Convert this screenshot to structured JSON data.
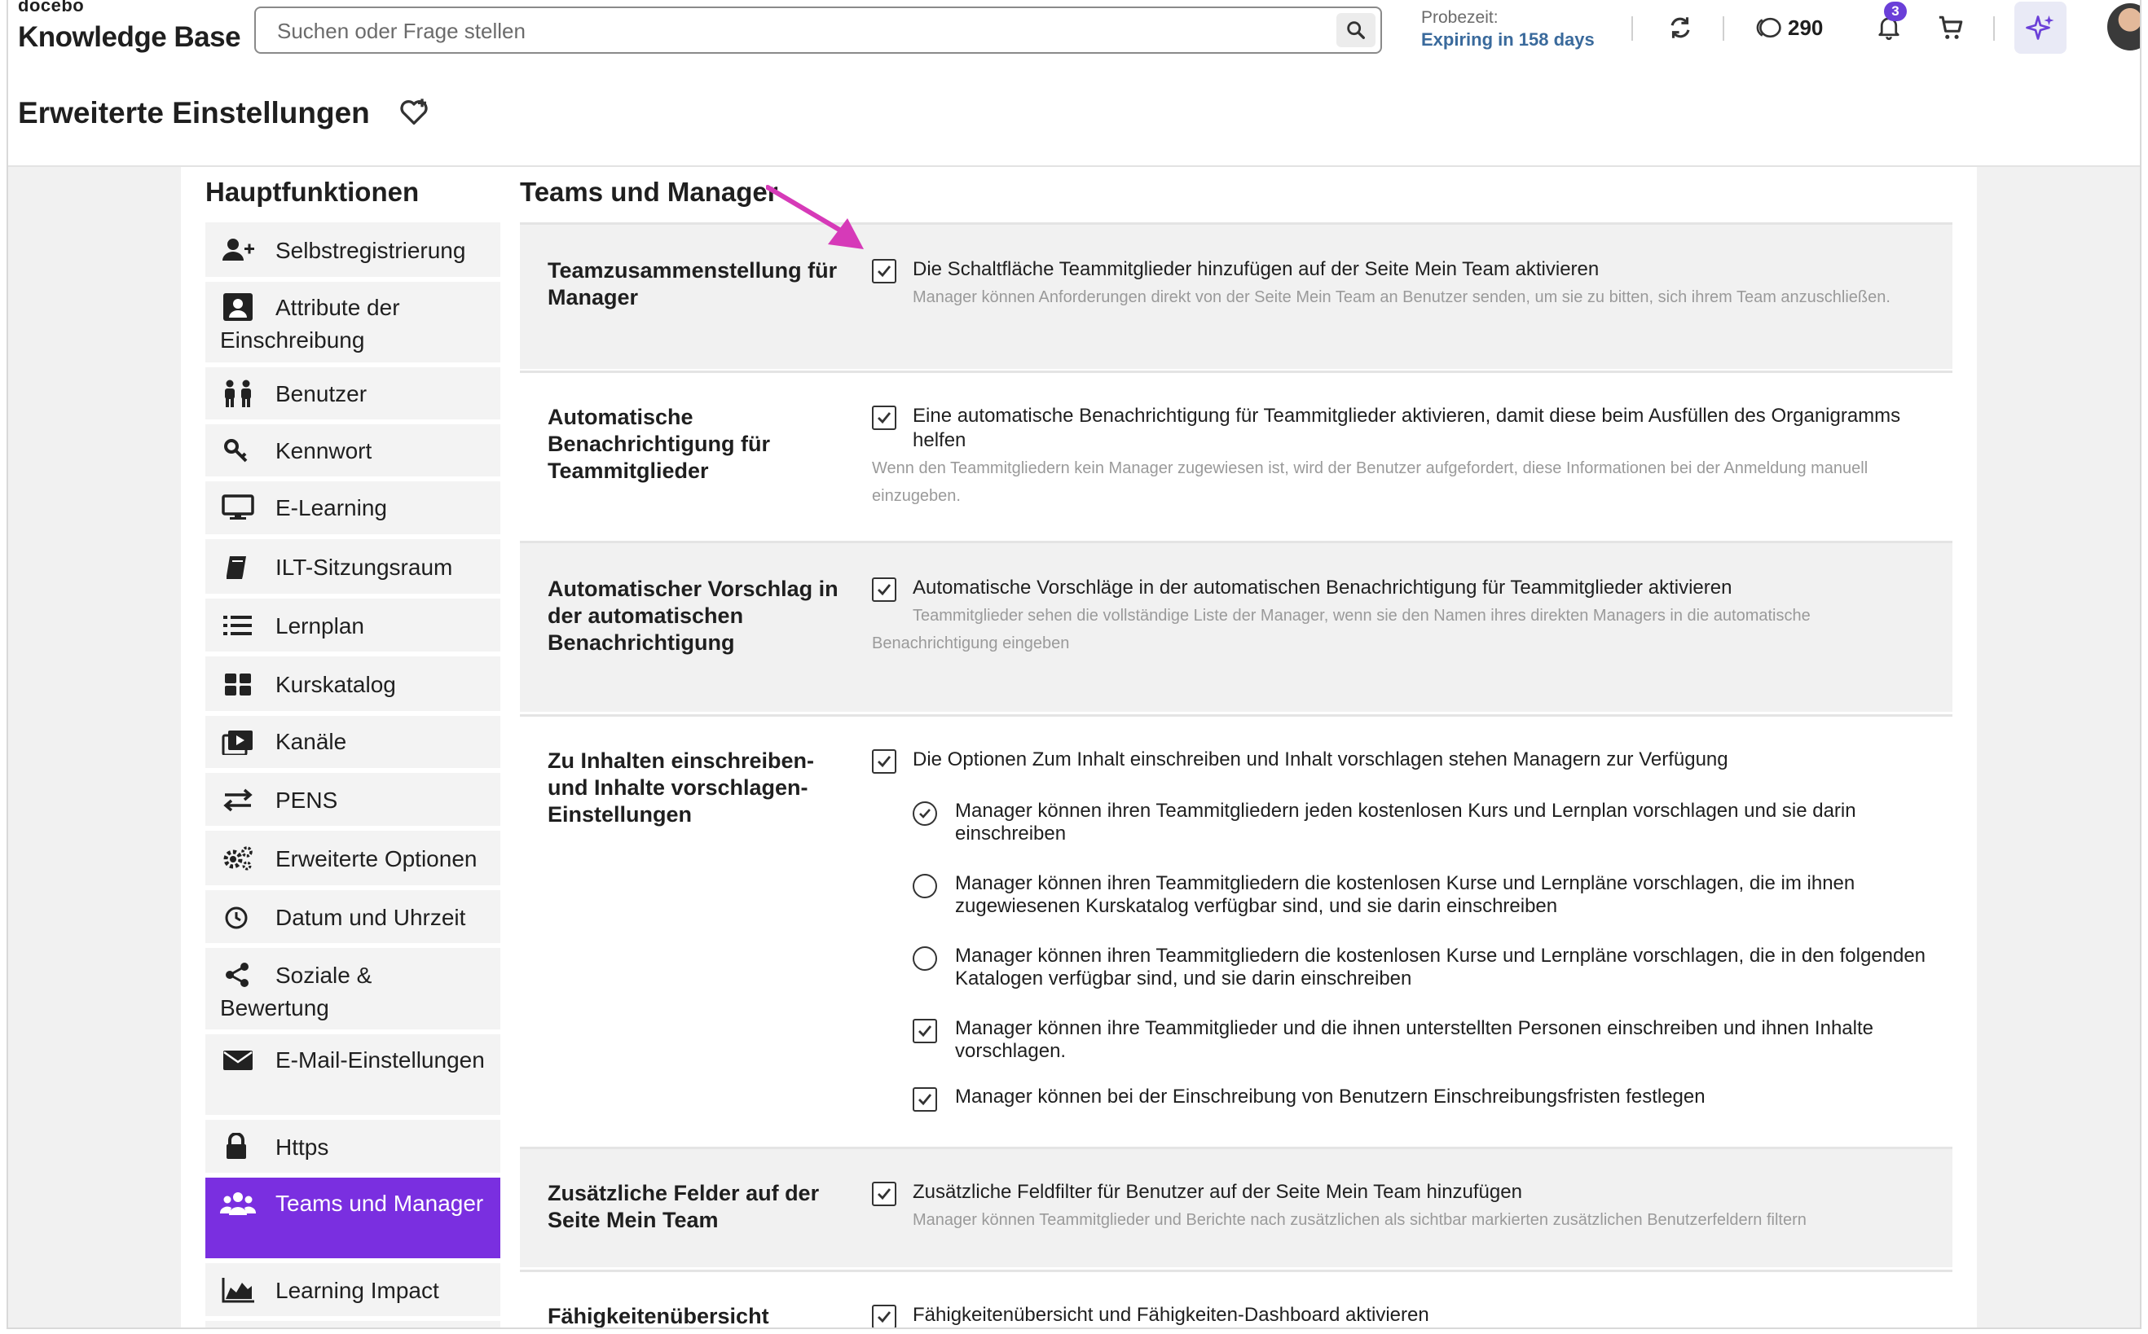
{
  "header": {
    "logo_small": "docebo",
    "logo_big": "Knowledge Base",
    "search_placeholder": "Suchen oder Frage stellen",
    "trial_label": "Probezeit:",
    "trial_value": "Expiring in 158 days",
    "credits": "290",
    "notifications": "3"
  },
  "page": {
    "title": "Erweiterte Einstellungen"
  },
  "sidebar": {
    "title": "Hauptfunktionen",
    "items": [
      {
        "label": "Selbstregistrierung",
        "icon": "user-plus-icon"
      },
      {
        "label": "Attribute der Einschreibung",
        "icon": "id-card-icon"
      },
      {
        "label": "Benutzer",
        "icon": "users-icon"
      },
      {
        "label": "Kennwort",
        "icon": "key-icon"
      },
      {
        "label": "E-Learning",
        "icon": "monitor-icon"
      },
      {
        "label": "ILT-Sitzungsraum",
        "icon": "book-icon"
      },
      {
        "label": "Lernplan",
        "icon": "list-icon"
      },
      {
        "label": "Kurskatalog",
        "icon": "grid-icon"
      },
      {
        "label": "Kanäle",
        "icon": "channels-icon"
      },
      {
        "label": "PENS",
        "icon": "arrows-exchange-icon"
      },
      {
        "label": "Erweiterte Optionen",
        "icon": "gears-icon"
      },
      {
        "label": "Datum und Uhrzeit",
        "icon": "clock-icon"
      },
      {
        "label": "Soziale & Bewertung",
        "icon": "share-icon"
      },
      {
        "label": "E-Mail-Einstellungen",
        "icon": "envelope-icon"
      },
      {
        "label": "Https",
        "icon": "lock-icon"
      },
      {
        "label": "Teams und Manager",
        "icon": "team-icon"
      },
      {
        "label": "Learning Impact",
        "icon": "area-chart-icon"
      }
    ]
  },
  "main": {
    "title": "Teams und Manager",
    "sections": [
      {
        "label": "Teamzusammenstellung für Manager",
        "option": "Die Schaltfläche Teammitglieder hinzufügen auf der Seite Mein Team aktivieren",
        "description": "Manager können Anforderungen direkt von der Seite Mein Team an Benutzer senden, um sie zu bitten, sich ihrem Team anzuschließen."
      },
      {
        "label": "Automatische Benachrichtigung für Teammitglieder",
        "option": "Eine automatische Benachrichtigung für Teammitglieder aktivieren, damit diese beim Ausfüllen des Organigramms helfen",
        "description": "Wenn den Teammitgliedern kein Manager zugewiesen ist, wird der Benutzer aufgefordert, diese Informationen bei der Anmeldung manuell einzugeben."
      },
      {
        "label": "Automatischer Vorschlag in der automatischen Benachrichtigung",
        "option": "Automatische Vorschläge in der automatischen Benachrichtigung für Teammitglieder aktivieren",
        "description": "Teammitglieder sehen die vollständige Liste der Manager, wenn sie den Namen ihres direkten Managers in die automatische Benachrichtigung eingeben"
      },
      {
        "label": "Zu Inhalten einschreiben- und Inhalte vorschlagen-Einstellungen",
        "option": "Die Optionen Zum Inhalt einschreiben und Inhalt vorschlagen stehen Managern zur Verfügung",
        "suboptions": [
          {
            "type": "radio",
            "selected": true,
            "label": "Manager können ihren Teammitgliedern jeden kostenlosen Kurs und Lernplan vorschlagen und sie darin einschreiben"
          },
          {
            "type": "radio",
            "selected": false,
            "label": "Manager können ihren Teammitgliedern die kostenlosen Kurse und Lernpläne vorschlagen, die im ihnen zugewiesenen Kurskatalog verfügbar sind, und sie darin einschreiben"
          },
          {
            "type": "radio",
            "selected": false,
            "label": "Manager können ihren Teammitgliedern die kostenlosen Kurse und Lernpläne vorschlagen, die in den folgenden Katalogen verfügbar sind, und sie darin einschreiben"
          },
          {
            "type": "checkbox",
            "selected": true,
            "label": "Manager können ihre Teammitglieder und die ihnen unterstellten Personen einschreiben und ihnen Inhalte vorschlagen."
          },
          {
            "type": "checkbox",
            "selected": true,
            "label": "Manager können bei der Einschreibung von Benutzern Einschreibungsfristen festlegen"
          }
        ]
      },
      {
        "label": "Zusätzliche Felder auf der Seite Mein Team",
        "option": "Zusätzliche Feldfilter für Benutzer auf der Seite Mein Team hinzufügen",
        "description": "Manager können Teammitglieder und Berichte nach zusätzlichen als sichtbar markierten zusätzlichen Benutzerfeldern filtern"
      },
      {
        "label": "Fähigkeitenübersicht",
        "option": "Fähigkeitenübersicht und Fähigkeiten-Dashboard aktivieren"
      }
    ]
  },
  "colors": {
    "accent": "#7a2fe0",
    "annotation_arrow": "#d63ab8",
    "trial_text": "#3a6a9c"
  }
}
